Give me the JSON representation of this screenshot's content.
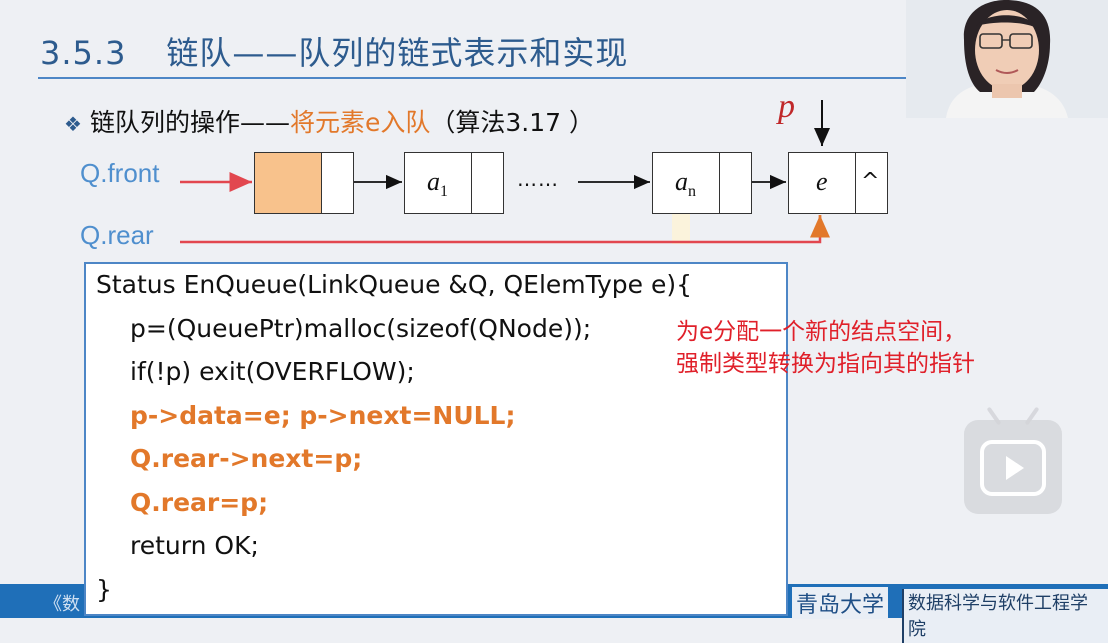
{
  "slide": {
    "section_number": "3.5.3",
    "title": "链队——队列的链式表示和实现",
    "bullet_prefix": "链队列的操作——",
    "bullet_highlight": "将元素e入队",
    "bullet_suffix": "（算法3.17 ）"
  },
  "diagram": {
    "front_label": "Q.front",
    "rear_label": "Q.rear",
    "pointer_label": "p",
    "node_a1": "a",
    "node_a1_sub": "1",
    "ellipsis": "……",
    "node_an": "a",
    "node_an_sub": "n",
    "node_e": "e",
    "null_symbol": "^",
    "colors": {
      "head_fill": "#f8c28c",
      "arrow_red": "#e2474f",
      "arrow_orange": "#e2782a"
    }
  },
  "code": {
    "lines": [
      "Status EnQueue(LinkQueue &Q, QElemType e){",
      "p=(QueuePtr)malloc(sizeof(QNode));",
      "if(!p) exit(OVERFLOW);",
      "p->data=e; p->next=NULL;",
      "Q.rear->next=p;",
      "Q.rear=p;",
      "return OK;",
      "}"
    ]
  },
  "notes": {
    "line1": "为e分配一个新的结点空间，",
    "line2": "强制类型转换为指向其的指针"
  },
  "footer": {
    "left_text": "《数",
    "logo_text": "青岛大学",
    "school": "数据科学与软件工程学院"
  },
  "overlay": {
    "play_icon": "play-icon"
  }
}
